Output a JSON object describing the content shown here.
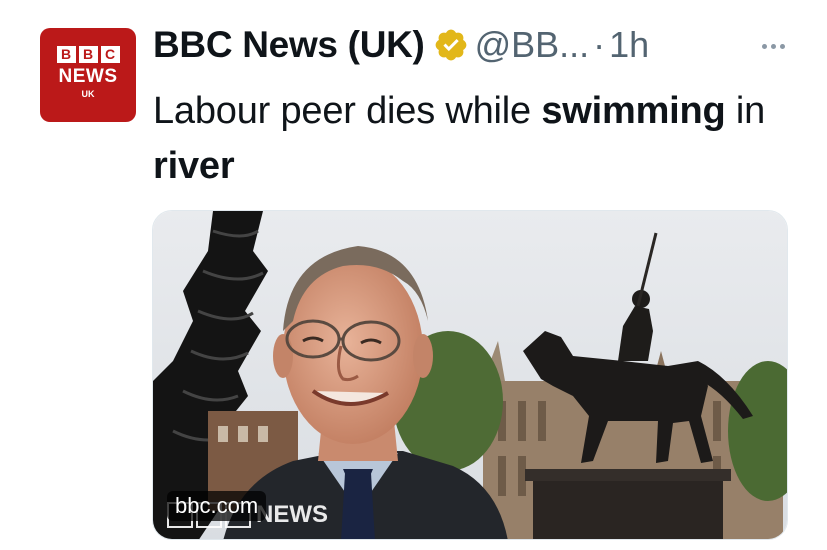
{
  "account": {
    "avatar_letters": [
      "B",
      "B",
      "C"
    ],
    "avatar_word": "NEWS",
    "avatar_sub": "UK",
    "display_name": "BBC News (UK)",
    "handle": "@BB...",
    "separator": "·",
    "time": "1h"
  },
  "tweet": {
    "segments": [
      {
        "text": "Labour peer dies while ",
        "bold": false
      },
      {
        "text": "swimming",
        "bold": true
      },
      {
        "text": " in ",
        "bold": false
      },
      {
        "text": "river",
        "bold": true
      }
    ]
  },
  "card": {
    "domain": "bbc.com",
    "watermark_word": "NEWS"
  },
  "colors": {
    "brand_red": "#bb1919",
    "verified_gold": "#e2b719",
    "secondary_text": "#536471"
  },
  "icons": {
    "verified": "verified-badge-icon",
    "more": "more-options-icon"
  }
}
